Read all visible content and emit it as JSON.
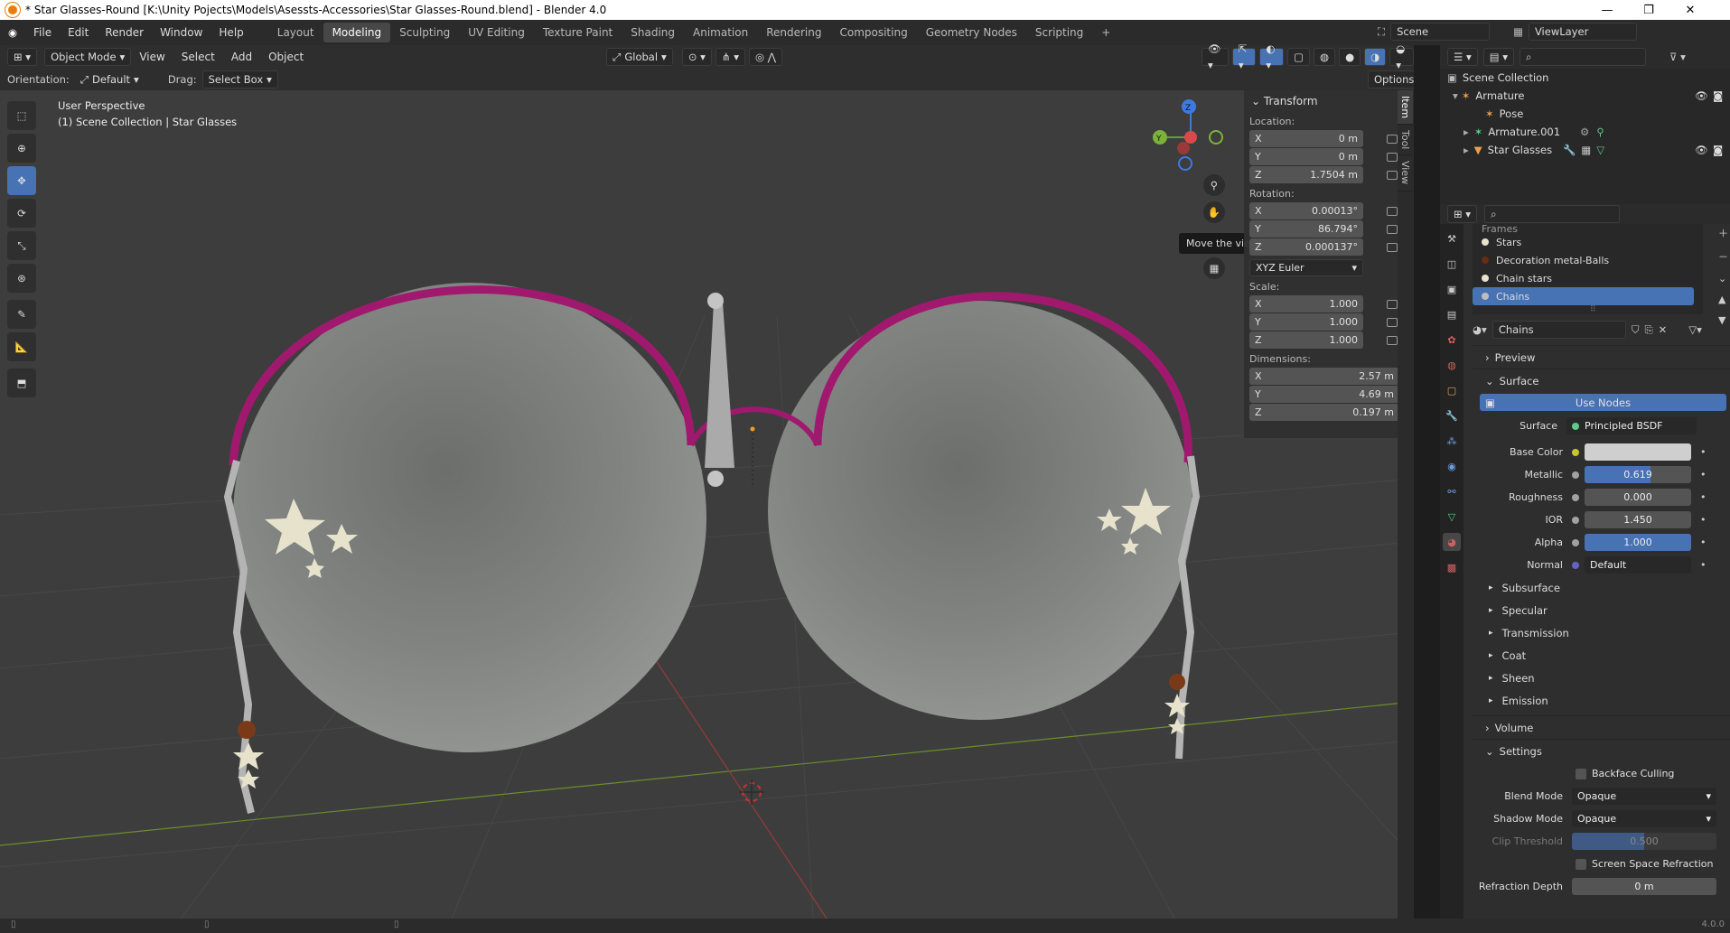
{
  "window": {
    "title": "* Star Glasses-Round [K:\\Unity Pojects\\Models\\Asessts-Accessories\\Star Glasses-Round.blend] - Blender 4.0"
  },
  "menus": [
    "File",
    "Edit",
    "Render",
    "Window",
    "Help"
  ],
  "workspaces": [
    "Layout",
    "Modeling",
    "Sculpting",
    "UV Editing",
    "Texture Paint",
    "Shading",
    "Animation",
    "Rendering",
    "Compositing",
    "Geometry Nodes",
    "Scripting"
  ],
  "scene": {
    "name": "Scene",
    "view_layer": "ViewLayer"
  },
  "header": {
    "mode": "Object Mode",
    "view": "View",
    "select": "Select",
    "add": "Add",
    "object": "Object",
    "transform_orientation": "Global"
  },
  "header2": {
    "orientation_label": "Orientation:",
    "orientation": "Default",
    "drag_label": "Drag:",
    "drag": "Select Box",
    "options": "Options"
  },
  "viewport": {
    "perspective": "User Perspective",
    "collection": "(1) Scene Collection | Star Glasses",
    "tooltip": "Move the view",
    "gizmo": {
      "z": "Z",
      "y": "Y"
    }
  },
  "ntabs": [
    "Item",
    "Tool",
    "View"
  ],
  "transform": {
    "title": "Transform",
    "location_label": "Location:",
    "location": [
      {
        "axis": "X",
        "value": "0 m"
      },
      {
        "axis": "Y",
        "value": "0 m"
      },
      {
        "axis": "Z",
        "value": "1.7504 m"
      }
    ],
    "rotation_label": "Rotation:",
    "rotation": [
      {
        "axis": "X",
        "value": "0.00013°"
      },
      {
        "axis": "Y",
        "value": "86.794°"
      },
      {
        "axis": "Z",
        "value": "0.000137°"
      }
    ],
    "rotation_mode": "XYZ Euler",
    "scale_label": "Scale:",
    "scale": [
      {
        "axis": "X",
        "value": "1.000"
      },
      {
        "axis": "Y",
        "value": "1.000"
      },
      {
        "axis": "Z",
        "value": "1.000"
      }
    ],
    "dimensions_label": "Dimensions:",
    "dimensions": [
      {
        "axis": "X",
        "value": "2.57 m"
      },
      {
        "axis": "Y",
        "value": "4.69 m"
      },
      {
        "axis": "Z",
        "value": "0.197 m"
      }
    ]
  },
  "outliner": {
    "root": "Scene Collection",
    "items": [
      {
        "name": "Armature",
        "indent": 1
      },
      {
        "name": "Pose",
        "indent": 2
      },
      {
        "name": "Armature.001",
        "indent": 2
      },
      {
        "name": "Star Glasses",
        "indent": 2
      }
    ]
  },
  "materials": {
    "slots": [
      "Frames",
      "Stars",
      "Decoration metal-Balls",
      "Chain stars",
      "Chains"
    ],
    "selected": "Chains",
    "name": "Chains"
  },
  "material_props": {
    "preview": "Preview",
    "surface": "Surface",
    "use_nodes": "Use Nodes",
    "surface_label": "Surface",
    "surface_shader": "Principled BSDF",
    "inputs": [
      {
        "label": "Base Color",
        "value": "",
        "dot": "#c7c729",
        "fill": 0,
        "color": "#cfcfcf"
      },
      {
        "label": "Metallic",
        "value": "0.619",
        "dot": "#a1a1a1",
        "fill": 0.619
      },
      {
        "label": "Roughness",
        "value": "0.000",
        "dot": "#a1a1a1",
        "fill": 0
      },
      {
        "label": "IOR",
        "value": "1.450",
        "dot": "#a1a1a1",
        "fill": 0
      },
      {
        "label": "Alpha",
        "value": "1.000",
        "dot": "#a1a1a1",
        "fill": 1
      },
      {
        "label": "Normal",
        "value": "Default",
        "dot": "#6363c7",
        "fill": 0
      }
    ],
    "subpanels": [
      "Subsurface",
      "Specular",
      "Transmission",
      "Coat",
      "Sheen",
      "Emission"
    ],
    "volume": "Volume",
    "settings": "Settings",
    "backface": "Backface Culling",
    "blend_mode_label": "Blend Mode",
    "blend_mode": "Opaque",
    "shadow_mode_label": "Shadow Mode",
    "shadow_mode": "Opaque",
    "clip_label": "Clip Threshold",
    "clip": "0.500",
    "ssr": "Screen Space Refraction",
    "refraction_label": "Refraction Depth",
    "refraction": "0 m"
  },
  "status": {
    "version": "4.0.0"
  }
}
